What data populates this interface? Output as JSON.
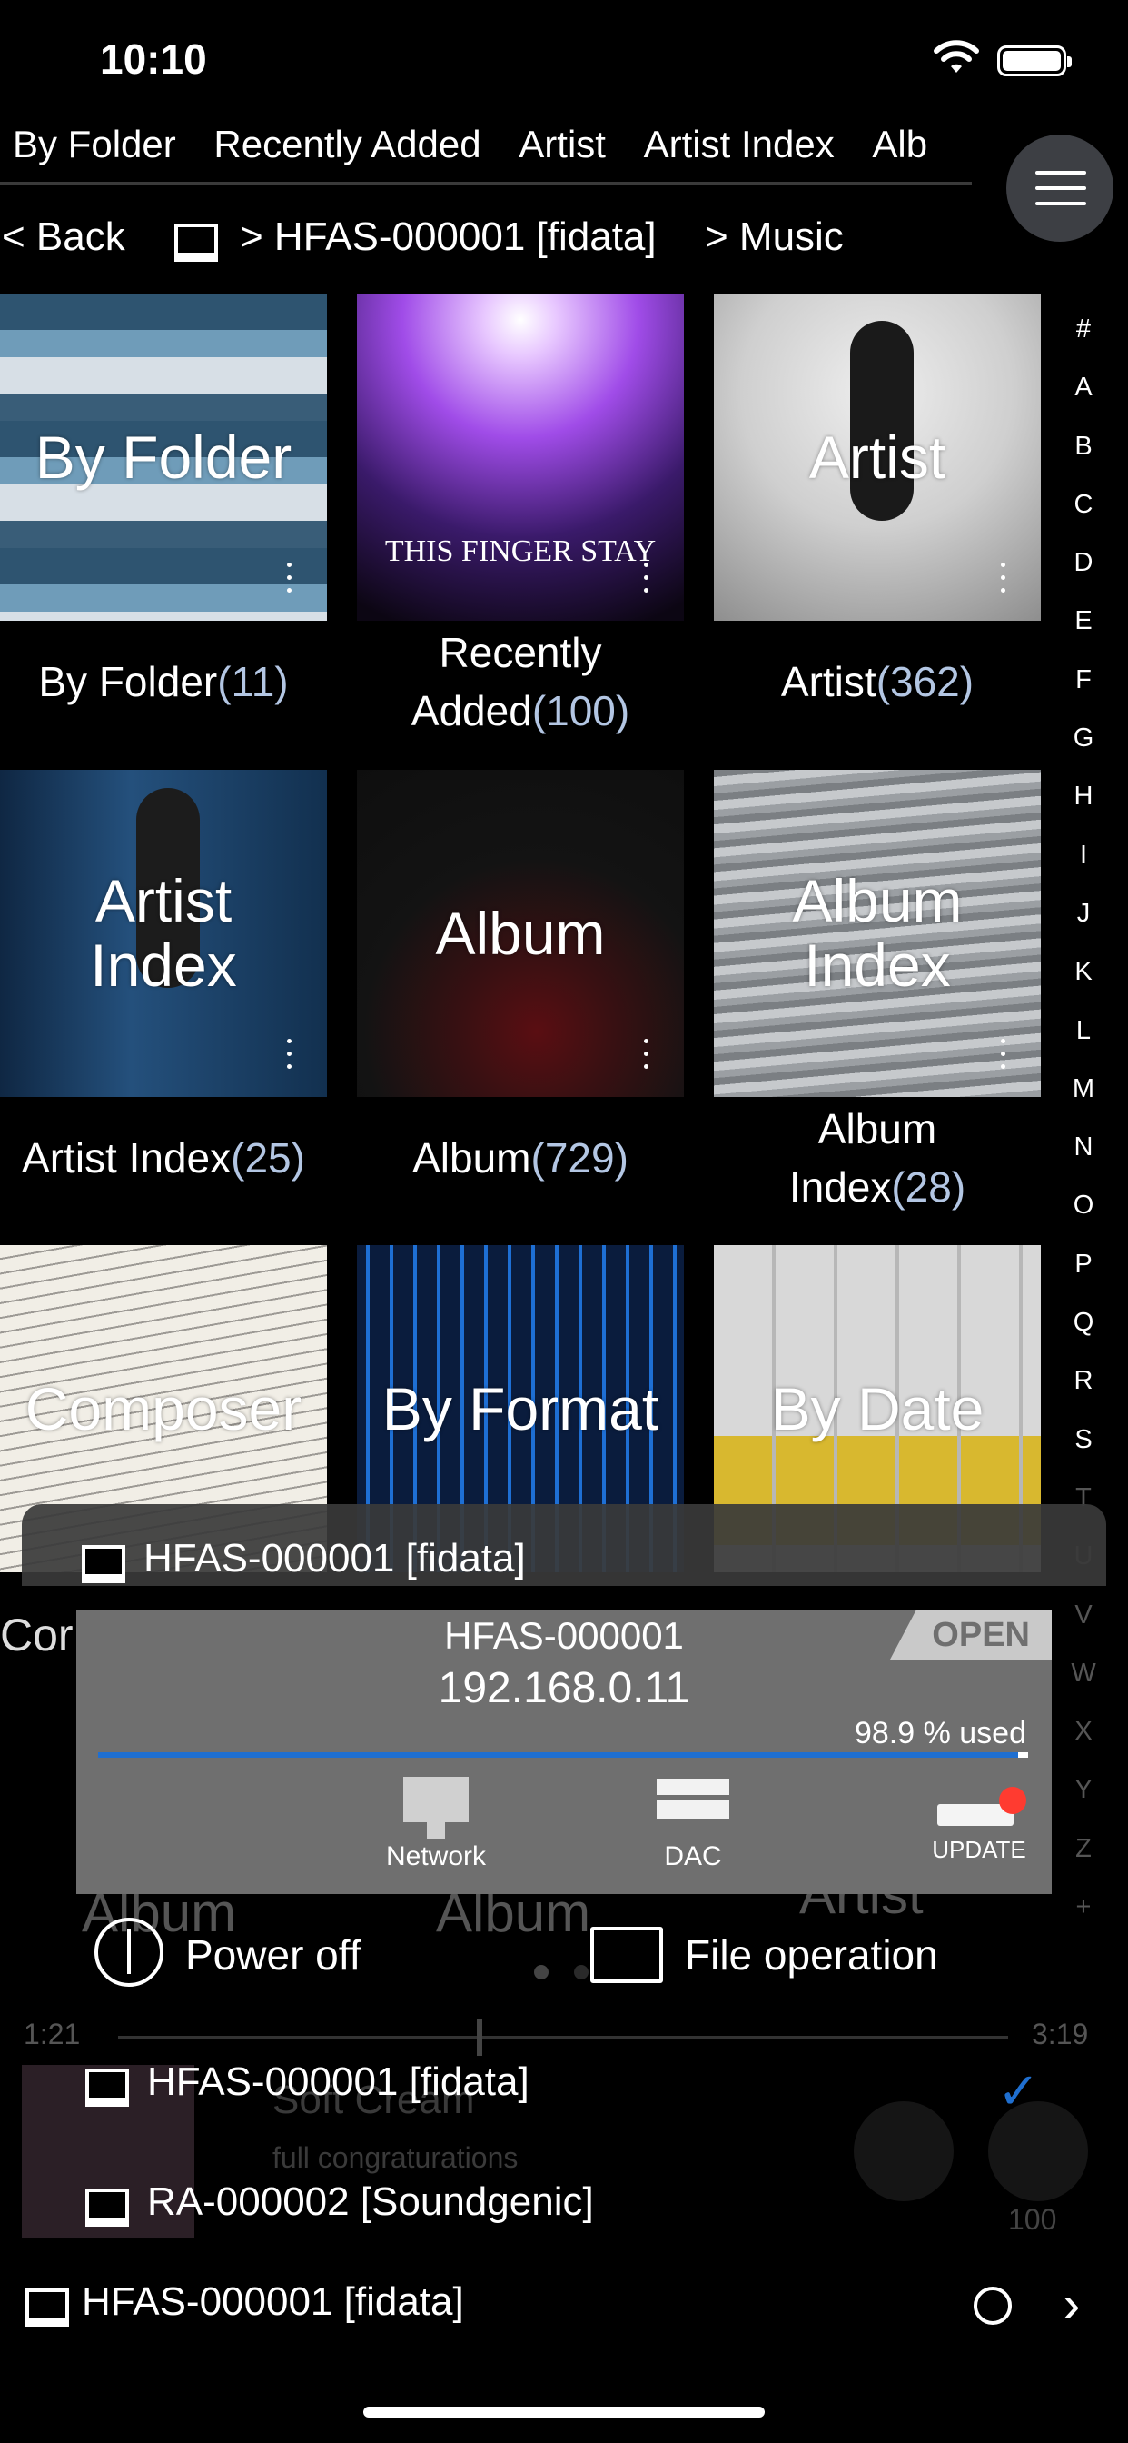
{
  "status": {
    "time": "10:10"
  },
  "tabs": [
    "By Folder",
    "Recently Added",
    "Artist",
    "Artist Index",
    "Alb"
  ],
  "breadcrumb": {
    "back": "< Back",
    "server": "> HFAS-000001 [fidata]",
    "folder": "> Music"
  },
  "tiles": [
    {
      "title": "By Folder",
      "caption": "By Folder",
      "count": "(11)"
    },
    {
      "title": "",
      "overlay_text": "THIS FINGER STAY",
      "caption_line1": "Recently",
      "caption_line2": "Added",
      "count": "(100)"
    },
    {
      "title": "Artist",
      "caption": "Artist",
      "count": "(362)"
    },
    {
      "title_line1": "Artist",
      "title_line2": "Index",
      "caption": "Artist Index",
      "count": "(25)"
    },
    {
      "title": "Album",
      "caption": "Album",
      "count": "(729)"
    },
    {
      "title_line1": "Album",
      "title_line2": "Index",
      "caption_line1": "Album",
      "caption_line2": "Index",
      "count": "(28)"
    },
    {
      "title": "Composer",
      "caption_partial": "Cor"
    },
    {
      "title": "By Format"
    },
    {
      "title": "By Date"
    }
  ],
  "alpha_index": [
    "#",
    "A",
    "B",
    "C",
    "D",
    "E",
    "F",
    "G",
    "H",
    "I",
    "J",
    "K",
    "L",
    "M",
    "N",
    "O",
    "P",
    "Q",
    "R",
    "S",
    "T",
    "U",
    "V",
    "W",
    "X",
    "Y",
    "Z",
    "+"
  ],
  "popup": {
    "title": "HFAS-000001 [fidata]",
    "device_name": "HFAS-000001",
    "ip": "192.168.0.11",
    "badge": "OPEN",
    "usage_text": "98.9 % used",
    "usage_percent": 98.9,
    "tools": {
      "network": "Network",
      "dac": "DAC",
      "update": "UPDATE"
    },
    "power_off": "Power off",
    "file_operation": "File operation"
  },
  "player": {
    "elapsed": "1:21",
    "total": "3:19",
    "track": "Soft Cream",
    "album": "full congraturations",
    "volume": "100",
    "partial_labels": [
      "Album",
      "Album",
      "Artist"
    ]
  },
  "device_list": [
    {
      "name": "HFAS-000001 [fidata]",
      "selected": true
    },
    {
      "name": "RA-000002 [Soundgenic]",
      "selected": false
    }
  ],
  "bottom": {
    "current_device": "HFAS-000001 [fidata]"
  },
  "colors": {
    "accent": "#1f6fd0",
    "count": "#b3c6e3",
    "update_dot": "#ff3b30"
  }
}
